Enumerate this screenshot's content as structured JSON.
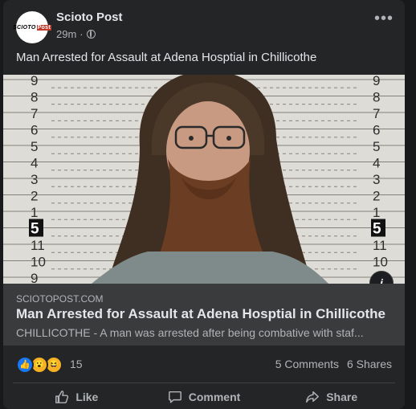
{
  "post": {
    "page_name": "Scioto Post",
    "avatar_text": "SCIOTO",
    "avatar_badge": "Post",
    "time": "29m",
    "text": "Man Arrested for Assault at Adena Hosptial in Chillicothe"
  },
  "photo": {
    "ruler_left": [
      "9",
      "8",
      "7",
      "6",
      "5",
      "4",
      "3",
      "2",
      "1",
      "5",
      "11",
      "10",
      "9"
    ],
    "ruler_right": [
      "9",
      "8",
      "7",
      "6",
      "5",
      "4",
      "3",
      "2",
      "1",
      "5",
      "11",
      "10",
      "9"
    ]
  },
  "link": {
    "domain": "SCIOTOPOST.COM",
    "title": "Man Arrested for Assault at Adena Hosptial in Chillicothe",
    "description": "CHILLICOTHE - A man was arrested after being combative with staf..."
  },
  "engagement": {
    "reaction_count": "15",
    "comments": "5 Comments",
    "shares": "6 Shares",
    "reaction_icons": [
      "like-icon",
      "wow-icon",
      "haha-icon"
    ]
  },
  "actions": {
    "like": "Like",
    "comment": "Comment",
    "share": "Share"
  },
  "colors": {
    "background": "#18191a",
    "card": "#242526",
    "link_box": "#3a3b3c",
    "like_blue": "#1877f2",
    "reaction_yellow": "#f7b125"
  }
}
